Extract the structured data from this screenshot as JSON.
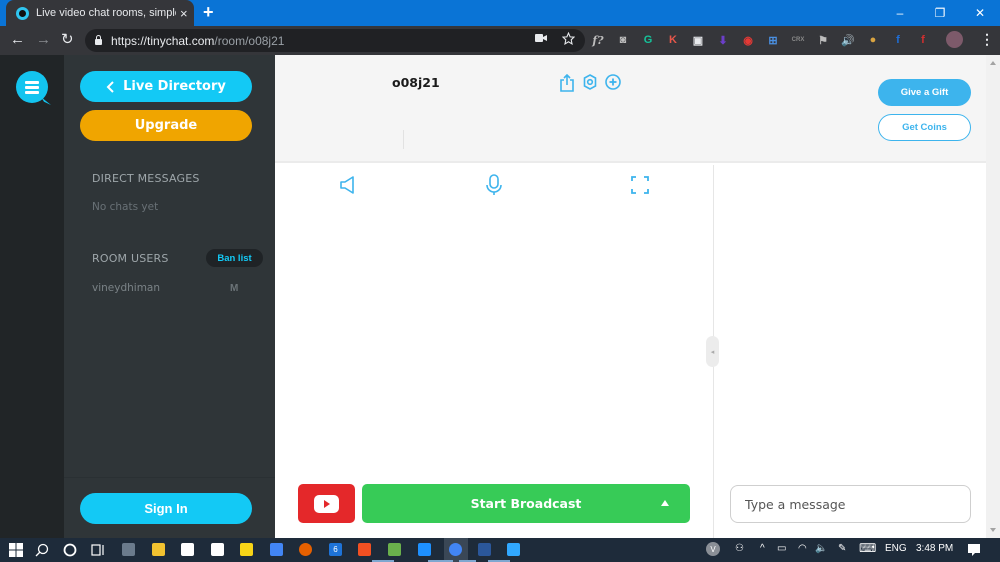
{
  "browser": {
    "tab": {
      "title": "Live video chat rooms, simple and",
      "close_icon": "×",
      "favicon": "tinychat-logo"
    },
    "new_tab_icon": "+",
    "window_controls": {
      "minimize": "–",
      "restore": "❐",
      "close": "✕"
    },
    "nav": {
      "back": "←",
      "forward": "→",
      "reload": "↻"
    },
    "url": {
      "host": "https://tinychat.com",
      "path": "/room/o08j21"
    },
    "omnibox_icons": [
      "camera-blocked-icon",
      "bookmark-star-icon"
    ],
    "extensions": [
      {
        "name": "font-detector-icon",
        "glyph": "f?",
        "color": "#bdbdbd"
      },
      {
        "name": "screenshot-icon",
        "glyph": "◙",
        "color": "#bdbdbd"
      },
      {
        "name": "grammarly-icon",
        "glyph": "G",
        "color": "#15c39a"
      },
      {
        "name": "keywords-icon",
        "glyph": "K",
        "color": "#e8574a"
      },
      {
        "name": "picture-in-picture-icon",
        "glyph": "▣",
        "color": "#e8eaed"
      },
      {
        "name": "downloader-icon",
        "glyph": "⬇",
        "color": "#6c3fc9"
      },
      {
        "name": "speed-test-icon",
        "glyph": "◉",
        "color": "#e53935"
      },
      {
        "name": "web-builder-icon",
        "glyph": "⊞",
        "color": "#4a90e2"
      },
      {
        "name": "get-crx-icon",
        "glyph": "CRX",
        "color": "#8a8a8a"
      },
      {
        "name": "flag-icon",
        "glyph": "⚑",
        "color": "#bdbdbd"
      },
      {
        "name": "volume-icon",
        "glyph": "🔊",
        "color": "#e8eaed"
      },
      {
        "name": "cookie-icon",
        "glyph": "●",
        "color": "#d9a441"
      },
      {
        "name": "facebook-icon",
        "glyph": "f",
        "color": "#1e6fd9"
      },
      {
        "name": "facebook-red-icon",
        "glyph": "f",
        "color": "#d32f2f"
      }
    ],
    "menu_icon": "⋮"
  },
  "sidebar": {
    "live_directory_label": "Live Directory",
    "upgrade_label": "Upgrade",
    "direct_messages_heading": "DIRECT MESSAGES",
    "no_chats_text": "No chats yet",
    "room_users_heading": "ROOM USERS",
    "ban_list_label": "Ban list",
    "users": [
      {
        "name": "vineydhiman",
        "badge": "M"
      }
    ],
    "sign_in_label": "Sign In"
  },
  "room": {
    "name": "o08j21",
    "header_icons": [
      "share-icon",
      "settings-icon",
      "add-icon"
    ],
    "give_gift_label": "Give a Gift",
    "get_coins_label": "Get Coins",
    "video_controls": [
      "speaker-icon",
      "microphone-icon",
      "fullscreen-icon"
    ],
    "collapse_handle_glyph": "◂",
    "broadcast_label": "Start Broadcast",
    "message_placeholder": "Type a message"
  },
  "colors": {
    "accent_cyan": "#13c9f5",
    "upgrade_orange": "#f0a500",
    "gift_blue": "#3db4ed",
    "broadcast_green": "#37cb57",
    "youtube_red": "#e4282a"
  },
  "taskbar": {
    "apps": [
      "windows-start-icon",
      "search-icon",
      "cortana-icon",
      "task-view-icon",
      "app-icon",
      "file-explorer-icon",
      "mail-icon",
      "settings-icon",
      "sticky-notes-icon",
      "google-ads-icon",
      "firefox-icon",
      "calendar-icon",
      "store-icon",
      "paint-icon",
      "edge-icon",
      "chrome-icon",
      "word-icon",
      "photoshop-icon"
    ],
    "calendar_day": "6",
    "avatar_letter": "V",
    "language": "ENG",
    "time": "3:48 PM"
  }
}
